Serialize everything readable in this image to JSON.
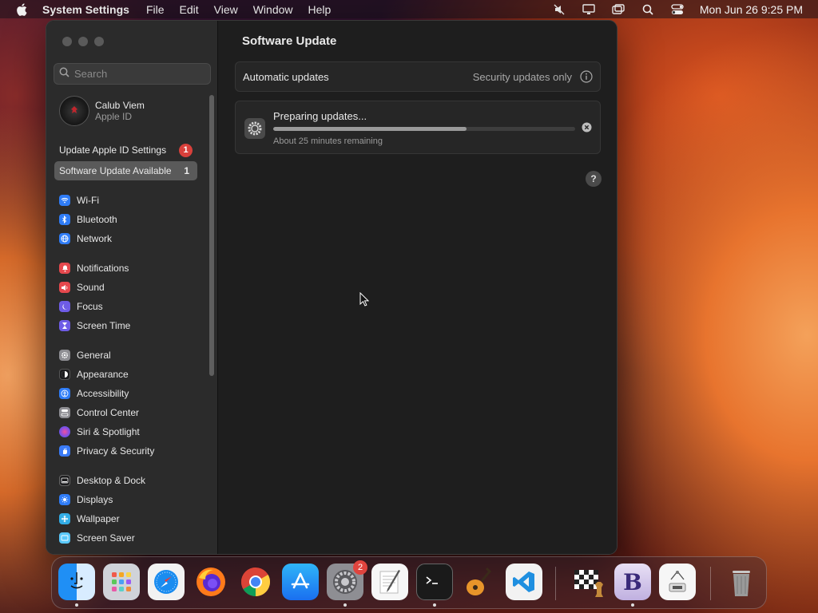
{
  "menubar": {
    "app_name": "System Settings",
    "menus": [
      "File",
      "Edit",
      "View",
      "Window",
      "Help"
    ],
    "clock": "Mon Jun 26  9:25 PM"
  },
  "sidebar": {
    "search_placeholder": "Search",
    "user": {
      "name": "Calub Viem",
      "subtitle": "Apple ID"
    },
    "notices": [
      {
        "label": "Update Apple ID Settings",
        "badge": "1"
      },
      {
        "label": "Software Update Available",
        "count": "1"
      }
    ],
    "items": [
      {
        "label": "Wi-Fi",
        "color": "#2f7cf6"
      },
      {
        "label": "Bluetooth",
        "color": "#2f7cf6"
      },
      {
        "label": "Network",
        "color": "#2f7cf6"
      },
      {
        "label": "Notifications",
        "color": "#e5484d"
      },
      {
        "label": "Sound",
        "color": "#e5484d"
      },
      {
        "label": "Focus",
        "color": "#6e5ce6"
      },
      {
        "label": "Screen Time",
        "color": "#6e5ce6"
      },
      {
        "label": "General",
        "color": "#8e8e93"
      },
      {
        "label": "Appearance",
        "color": "#1c1c1e"
      },
      {
        "label": "Accessibility",
        "color": "#2f7cf6"
      },
      {
        "label": "Control Center",
        "color": "#8e8e93"
      },
      {
        "label": "Siri & Spotlight",
        "color": "#b24fd6"
      },
      {
        "label": "Privacy & Security",
        "color": "#3a7bf7"
      },
      {
        "label": "Desktop & Dock",
        "color": "#1c1c1e"
      },
      {
        "label": "Displays",
        "color": "#2f7cf6"
      },
      {
        "label": "Wallpaper",
        "color": "#32ade6"
      },
      {
        "label": "Screen Saver",
        "color": "#5ac8fa"
      }
    ]
  },
  "main": {
    "title": "Software Update",
    "auto_updates": {
      "label": "Automatic updates",
      "value": "Security updates only"
    },
    "progress": {
      "title": "Preparing updates...",
      "subtitle": "About 25 minutes remaining",
      "fraction": 0.64
    },
    "help": "?"
  },
  "dock": {
    "settings_badge": "2",
    "apps": [
      "finder",
      "launchpad",
      "safari",
      "firefox",
      "chrome",
      "app-store",
      "system-settings",
      "textedit",
      "terminal",
      "garageband",
      "vscode",
      "chess",
      "bbedit",
      "preview-scanner",
      "trash"
    ]
  }
}
